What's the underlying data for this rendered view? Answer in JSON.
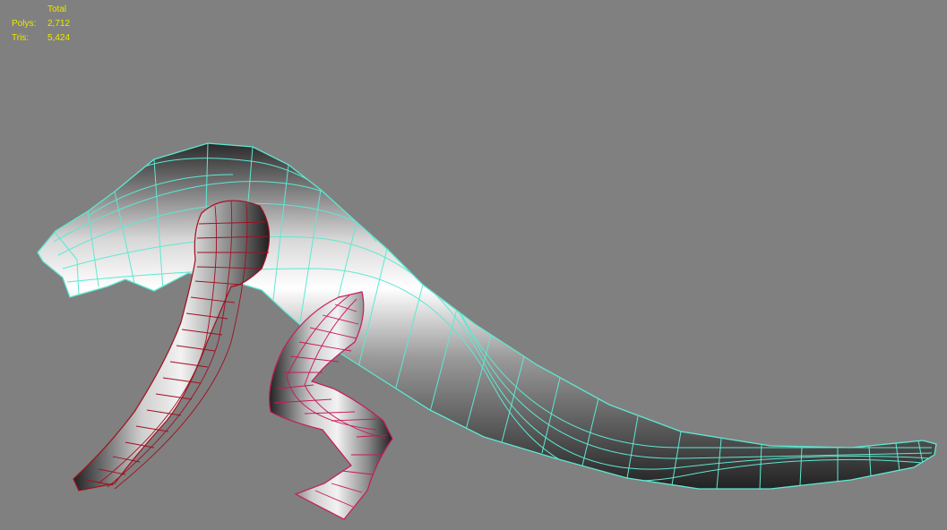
{
  "stats": {
    "header": "Total",
    "polys_label": "Polys:",
    "polys_value": "2,712",
    "tris_label": "Tris:",
    "tris_value": "5,424"
  },
  "colors": {
    "background": "#808080",
    "stats_text": "#e8e800",
    "body_wire": "#5ee8d2",
    "limb_wire": "#c8185c",
    "arm_wire": "#a01020"
  }
}
